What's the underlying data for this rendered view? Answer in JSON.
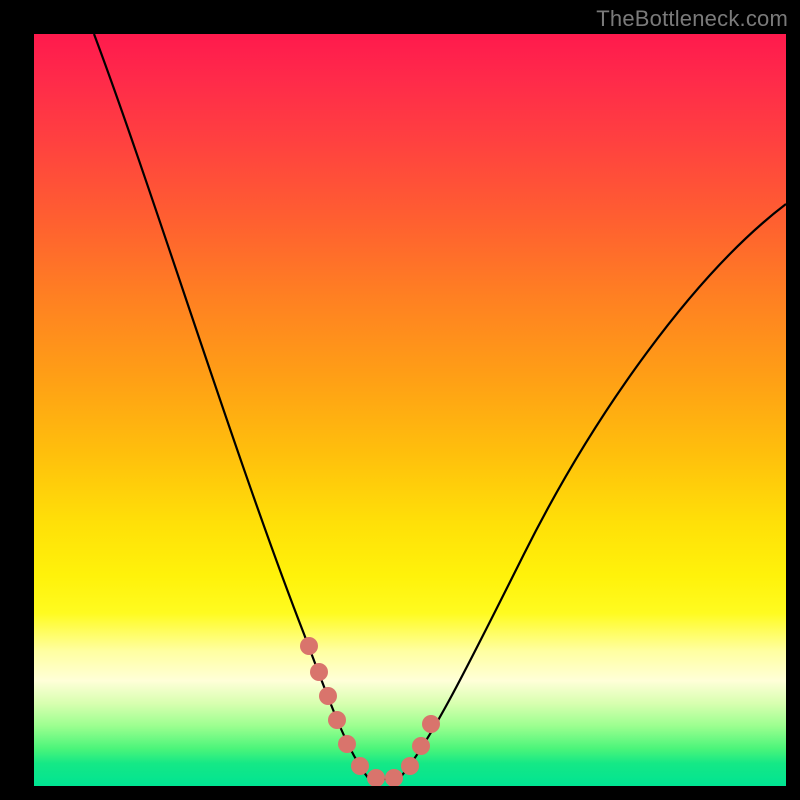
{
  "watermark": {
    "text": "TheBottleneck.com"
  },
  "colors": {
    "background": "#000000",
    "gradient_top": "#ff1a4d",
    "gradient_mid": "#ffe008",
    "gradient_bottom": "#00e492",
    "curve": "#000000",
    "marker": "#d9746c"
  },
  "chart_data": {
    "type": "line",
    "title": "",
    "xlabel": "",
    "ylabel": "",
    "xlim": [
      0,
      100
    ],
    "ylim": [
      0,
      100
    ],
    "grid": false,
    "legend": false,
    "series": [
      {
        "name": "bottleneck-curve",
        "x": [
          8,
          12,
          16,
          20,
          24,
          28,
          32,
          35,
          38,
          40,
          42,
          44,
          46,
          48,
          52,
          56,
          60,
          66,
          74,
          82,
          90,
          100
        ],
        "y": [
          100,
          88,
          76,
          65,
          54,
          43,
          32,
          22,
          13,
          7,
          3,
          1,
          0,
          0,
          2,
          7,
          14,
          24,
          38,
          50,
          60,
          70
        ]
      }
    ],
    "annotations": [
      {
        "name": "valley-markers",
        "points_x": [
          36,
          37.2,
          38.5,
          40,
          41.5,
          44,
          46.5,
          48.5,
          50,
          51.2,
          52.2
        ],
        "points_y": [
          18,
          14,
          10,
          6,
          3,
          1,
          1,
          3,
          6,
          9,
          12
        ]
      }
    ]
  }
}
